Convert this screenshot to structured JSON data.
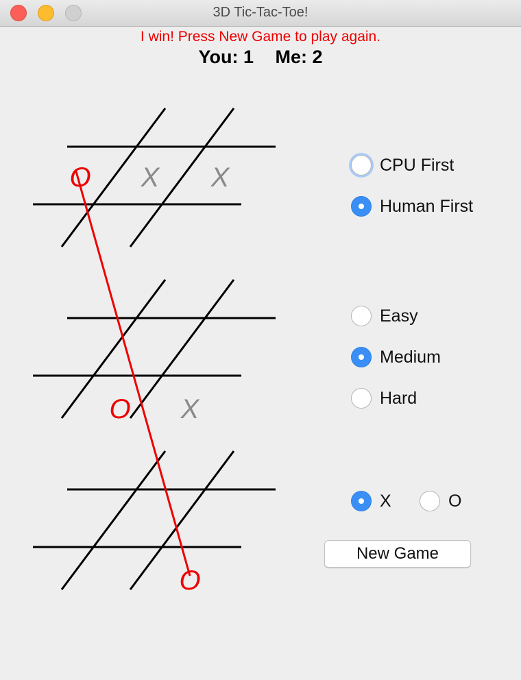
{
  "window": {
    "title": "3D Tic-Tac-Toe!"
  },
  "status": {
    "message": "I win! Press New Game to play again.",
    "color": "#ee0000"
  },
  "score": {
    "you": "You: 1",
    "me": "Me: 2"
  },
  "board": {
    "layers": [
      {
        "cells": [
          "O",
          "X",
          "X",
          "",
          "",
          "",
          "",
          "",
          ""
        ]
      },
      {
        "cells": [
          "",
          "",
          "",
          "",
          "O",
          "X",
          "",
          "",
          ""
        ]
      },
      {
        "cells": [
          "",
          "",
          "",
          "",
          "",
          "O",
          "",
          "",
          ""
        ]
      }
    ],
    "winning_cells": [
      [
        0,
        0
      ],
      [
        1,
        4
      ],
      [
        2,
        5
      ]
    ],
    "x_color": "#8a8a8a",
    "o_color": "#ee0000",
    "win_line_color": "#ee0000"
  },
  "options": {
    "first": [
      {
        "label": "CPU First",
        "checked": false,
        "focused": true
      },
      {
        "label": "Human First",
        "checked": true
      }
    ],
    "difficulty": [
      {
        "label": "Easy",
        "checked": false
      },
      {
        "label": "Medium",
        "checked": true
      },
      {
        "label": "Hard",
        "checked": false
      }
    ],
    "symbol": [
      {
        "label": "X",
        "checked": true
      },
      {
        "label": "O",
        "checked": false
      }
    ]
  },
  "new_game_label": "New Game"
}
